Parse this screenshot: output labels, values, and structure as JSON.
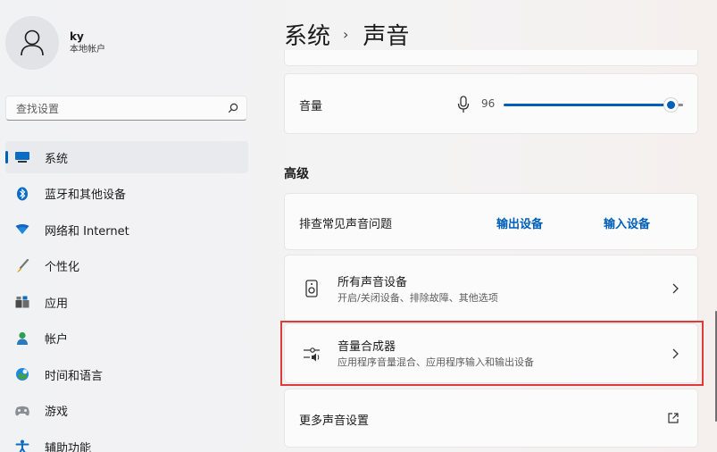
{
  "profile": {
    "name": "ky",
    "account_type": "本地帐户"
  },
  "search": {
    "placeholder": "查找设置"
  },
  "nav": {
    "items": [
      {
        "label": "系统",
        "icon": "monitor-icon",
        "active": true
      },
      {
        "label": "蓝牙和其他设备",
        "icon": "bluetooth-icon"
      },
      {
        "label": "网络和 Internet",
        "icon": "wifi-icon"
      },
      {
        "label": "个性化",
        "icon": "brush-icon"
      },
      {
        "label": "应用",
        "icon": "apps-icon"
      },
      {
        "label": "帐户",
        "icon": "person-icon"
      },
      {
        "label": "时间和语言",
        "icon": "globe-clock-icon"
      },
      {
        "label": "游戏",
        "icon": "gamepad-icon"
      },
      {
        "label": "辅助功能",
        "icon": "accessibility-icon"
      }
    ]
  },
  "breadcrumb": {
    "parent": "系统",
    "separator": "›",
    "current": "声音"
  },
  "volume": {
    "label": "音量",
    "value": "96",
    "level_percent": 96
  },
  "advanced": {
    "heading": "高级",
    "troubleshoot": {
      "label": "排查常见声音问题",
      "output_link": "输出设备",
      "input_link": "输入设备"
    },
    "all_devices": {
      "title": "所有声音设备",
      "subtitle": "开启/关闭设备、排除故障、其他选项"
    },
    "mixer": {
      "title": "音量合成器",
      "subtitle": "应用程序音量混合、应用程序输入和输出设备"
    },
    "more": {
      "label": "更多声音设置"
    }
  },
  "colors": {
    "accent": "#005fb8",
    "highlight": "#e03a3a"
  }
}
